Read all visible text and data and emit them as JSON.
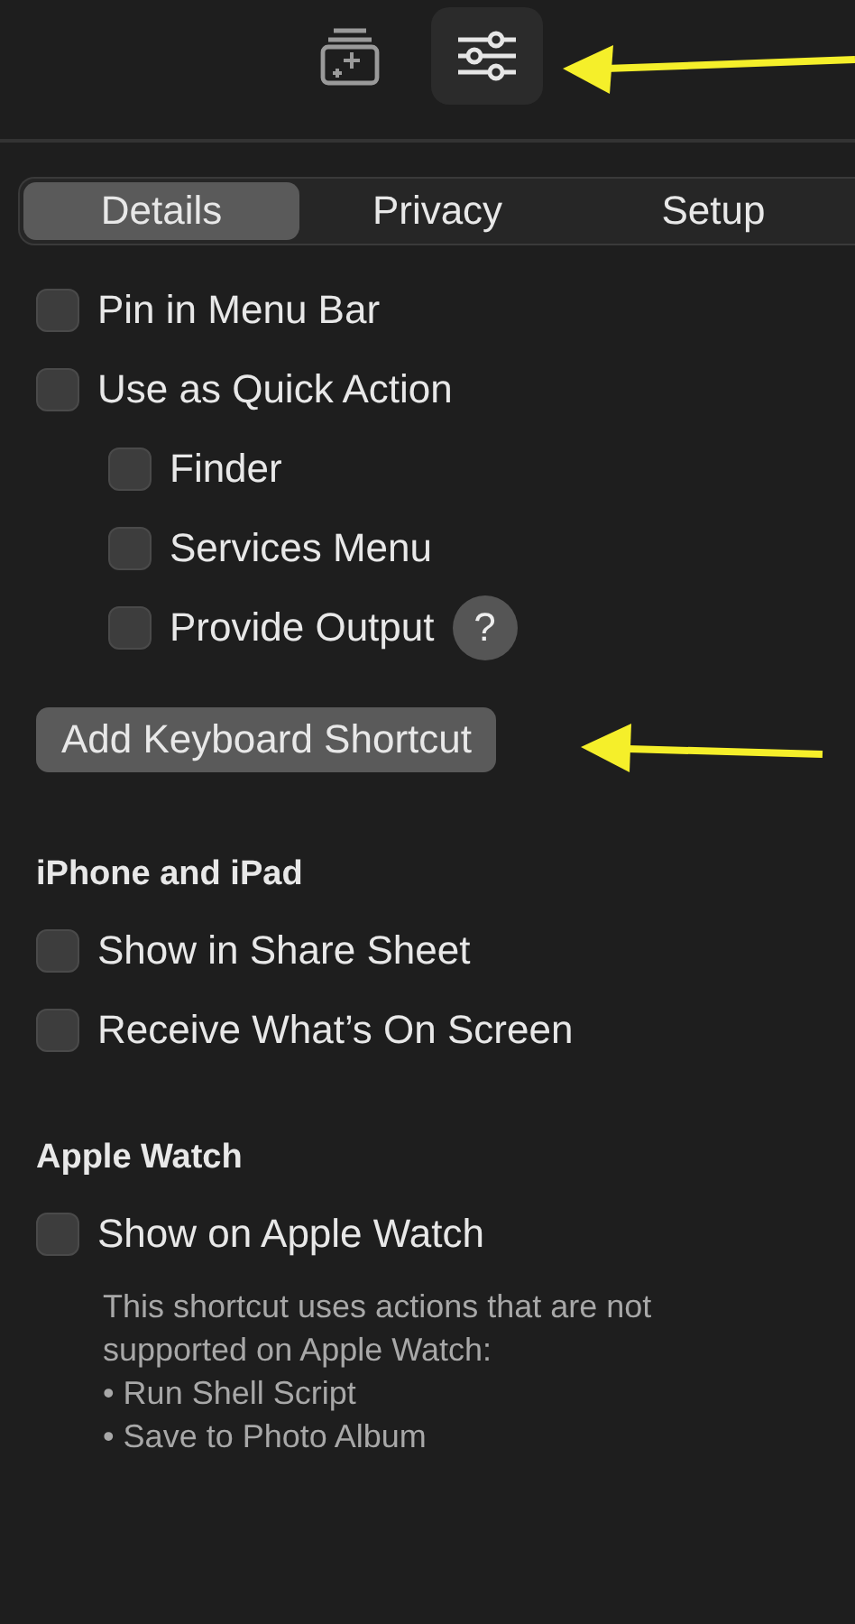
{
  "toolbar": {
    "buttons": [
      {
        "kind": "library",
        "selected": false
      },
      {
        "kind": "settings",
        "selected": true
      }
    ]
  },
  "tabs": [
    {
      "label": "Details",
      "selected": true
    },
    {
      "label": "Privacy",
      "selected": false
    },
    {
      "label": "Setup",
      "selected": false
    }
  ],
  "options": [
    {
      "label": "Pin in Menu Bar",
      "checked": false
    },
    {
      "label": "Use as Quick Action",
      "checked": false,
      "children": [
        {
          "label": "Finder",
          "checked": false
        },
        {
          "label": "Services Menu",
          "checked": false
        },
        {
          "label": "Provide Output",
          "checked": false,
          "help": "?"
        }
      ]
    }
  ],
  "shortcut_button": "Add Keyboard Shortcut",
  "sections": [
    {
      "title": "iPhone and iPad",
      "options": [
        {
          "label": "Show in Share Sheet",
          "checked": false
        },
        {
          "label": "Receive What’s On Screen",
          "checked": false
        }
      ]
    },
    {
      "title": "Apple Watch",
      "options": [
        {
          "label": "Show on Apple Watch",
          "checked": false
        }
      ],
      "note": "This shortcut uses actions that are not supported on Apple Watch:",
      "note_items": [
        "• Run Shell Script",
        "• Save to Photo Album"
      ]
    }
  ]
}
